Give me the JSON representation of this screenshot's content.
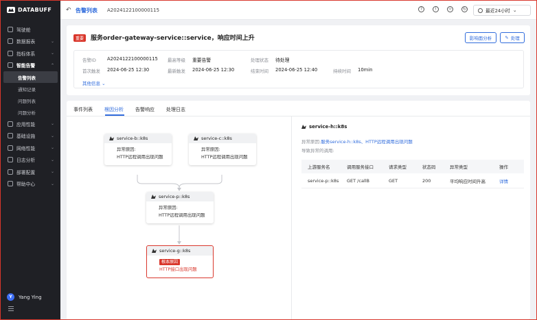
{
  "app": {
    "brand": "DATABUFF"
  },
  "sidebar": {
    "items": [
      {
        "label": "驾驶舱",
        "icon": "dashboard-icon",
        "chevron": false
      },
      {
        "label": "数据报表",
        "icon": "report-icon",
        "chevron": true
      },
      {
        "label": "指标体系",
        "icon": "metrics-icon",
        "chevron": true
      },
      {
        "label": "智能告警",
        "icon": "alarm-icon",
        "chevron": true,
        "open": true
      },
      {
        "label": "应用性能",
        "icon": "apm-icon",
        "chevron": true
      },
      {
        "label": "基础设施",
        "icon": "infra-icon",
        "chevron": true
      },
      {
        "label": "网络性能",
        "icon": "network-icon",
        "chevron": true
      },
      {
        "label": "日志分析",
        "icon": "log-icon",
        "chevron": true
      },
      {
        "label": "部署配置",
        "icon": "deploy-icon",
        "chevron": true
      },
      {
        "label": "帮助中心",
        "icon": "help-icon",
        "chevron": true
      }
    ],
    "sub_items": [
      {
        "label": "告警列表",
        "active": true
      },
      {
        "label": "通知记录"
      },
      {
        "label": "问题列表"
      },
      {
        "label": "问题分析"
      }
    ],
    "user": {
      "initial": "Y",
      "name": "Yang Ying"
    }
  },
  "topbar": {
    "back_icon": "↶",
    "title": "告警列表",
    "alert_id": "A2024122100000115",
    "time_range": "最近24小时",
    "icons": [
      "help-icon",
      "bell-icon",
      "theme-icon",
      "refresh-icon"
    ]
  },
  "alert": {
    "severity_tag": "重要",
    "title": "服务order-gateway-service::service，响应时间上升",
    "btn_impact": "影响面分析",
    "btn_handle": "处理",
    "fields": {
      "alert_id_label": "告警ID",
      "alert_id": "A2024122100000115",
      "max_level_label": "最高等级",
      "max_level": "重要告警",
      "status_label": "处理状态",
      "status": "待处理",
      "first_label": "首次触发",
      "first": "2024-06-25 12:30",
      "latest_label": "最新触发",
      "latest": "2024-06-25 12:30",
      "end_label": "结束时间",
      "end": "2024-06-25 12:40",
      "duration_label": "持续时间",
      "duration": "10min"
    },
    "more": "其他信息"
  },
  "tabs": [
    "事件列表",
    "根因分析",
    "告警响应",
    "处理日志"
  ],
  "graph": {
    "nodes": [
      {
        "name": "service-b::k8s",
        "reason_label": "异常原因:",
        "reason": "HTTP远程调用出现问题"
      },
      {
        "name": "service-c::k8s",
        "reason_label": "异常原因:",
        "reason": "HTTP远程调用出现问题"
      },
      {
        "name": "service-p::k8s",
        "reason_label": "异常原因:",
        "reason": "HTTP远程调用出现问题"
      },
      {
        "name": "service-g::k8s",
        "root_tag": "根本原因",
        "reason": "HTTP接口出现问题"
      }
    ]
  },
  "detail": {
    "title": "service-h::k8s",
    "reason_label": "异常原因:",
    "reason_link": "服务service-h::k8s、HTTP远程调用出现问题",
    "caused_label": "导致异常的调用:",
    "columns": [
      "上游服务名",
      "调用服务接口",
      "请求类型",
      "状态码",
      "异常类型",
      "操作"
    ],
    "rows": [
      [
        "service-p::k8s",
        "GET /callB",
        "GET",
        "200",
        "平均响应时间升高",
        "详情"
      ]
    ]
  }
}
